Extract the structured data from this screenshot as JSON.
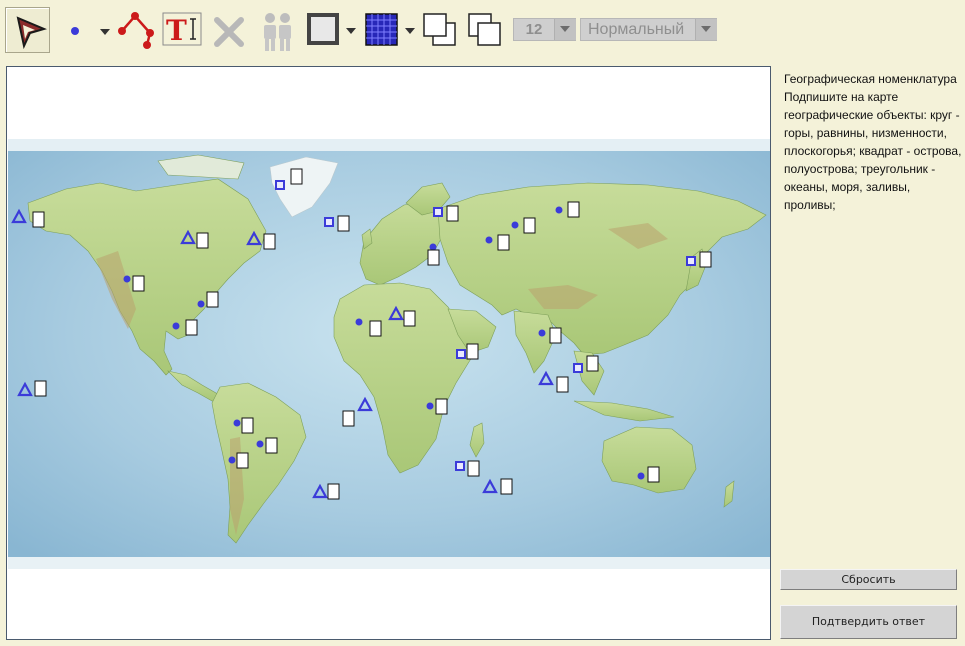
{
  "toolbar": {
    "icons": [
      "select-arrow-icon",
      "point-tool-icon",
      "polyline-tool-icon",
      "text-tool-icon",
      "delete-icon",
      "group-icon",
      "border-style-icon",
      "fill-pattern-icon",
      "bring-front-icon",
      "send-back-icon"
    ],
    "font_size_value": "12",
    "font_style_value": "Нормальный",
    "colors": {
      "accent_blue": "#3b3bd9",
      "red": "#cc1a1a",
      "disabled_gray": "#b8b8b8"
    }
  },
  "instructions": {
    "text": "Географическая номенклатура\nПодпишите на карте географические объекты: круг - горы, равнины, низменности, плоскогорья; квадрат - острова, полуострова; треугольник - океаны, моря, заливы, проливы;"
  },
  "buttons": {
    "reset_label": "Сбросить",
    "submit_label": "Подтвердить ответ"
  },
  "map": {
    "marker_types": [
      "circle",
      "square",
      "triangle"
    ],
    "marker_color": "#3b3bd9"
  }
}
